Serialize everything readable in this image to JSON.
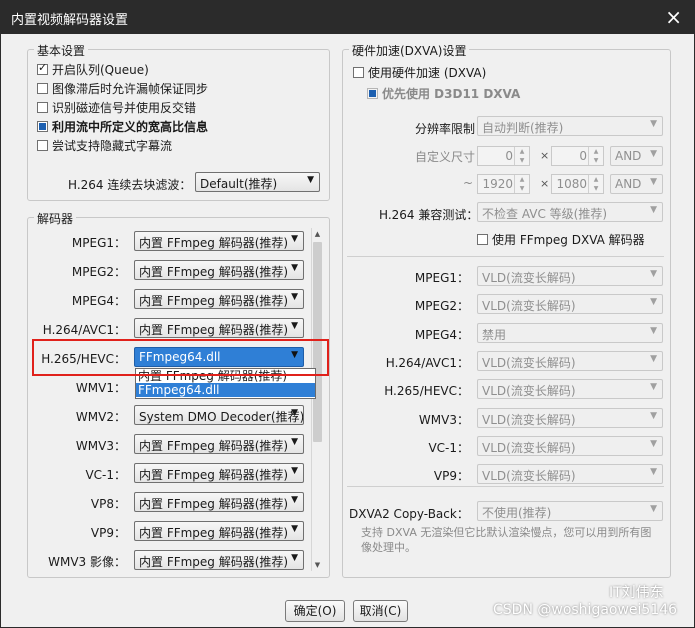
{
  "window": {
    "title": "内置视频解码器设置",
    "close_icon": "×"
  },
  "basic": {
    "legend": "基本设置",
    "options": [
      {
        "label": "开启队列(Queue)",
        "state": "checked",
        "bold": false
      },
      {
        "label": "图像滞后时允许漏帧保证同步",
        "state": "unchecked",
        "bold": false
      },
      {
        "label": "识别磁迹信号并使用反交错",
        "state": "unchecked",
        "bold": false
      },
      {
        "label": "利用流中所定义的宽高比信息",
        "state": "filled",
        "bold": true
      },
      {
        "label": "尝试支持隐藏式字幕流",
        "state": "unchecked",
        "bold": false
      }
    ],
    "deblock_label": "H.264 连续去块滤波：",
    "deblock_value": "Default(推荐)"
  },
  "decoders": {
    "legend": "解码器",
    "rows": [
      {
        "label": "MPEG1：",
        "value": "内置 FFmpeg 解码器(推荐)"
      },
      {
        "label": "MPEG2：",
        "value": "内置 FFmpeg 解码器(推荐)"
      },
      {
        "label": "MPEG4：",
        "value": "内置 FFmpeg 解码器(推荐)"
      },
      {
        "label": "H.264/AVC1：",
        "value": "内置 FFmpeg 解码器(推荐)"
      },
      {
        "label": "H.265/HEVC：",
        "value": "FFmpeg64.dll"
      },
      {
        "label": "WMV1：",
        "value": ""
      },
      {
        "label": "WMV2：",
        "value": "System DMO Decoder(推荐)"
      },
      {
        "label": "WMV3：",
        "value": "内置 FFmpeg 解码器(推荐)"
      },
      {
        "label": "VC-1：",
        "value": "内置 FFmpeg 解码器(推荐)"
      },
      {
        "label": "VP8：",
        "value": "内置 FFmpeg 解码器(推荐)"
      },
      {
        "label": "VP9：",
        "value": "内置 FFmpeg 解码器(推荐)"
      },
      {
        "label": "WMV3 影像：",
        "value": "内置 FFmpeg 解码器(推荐)"
      }
    ],
    "open_dropdown": [
      "内置 FFmpeg 解码器(推荐)",
      "FFmpeg64.dll"
    ]
  },
  "hw": {
    "legend": "硬件加速(DXVA)设置",
    "use_hw": "使用硬件加速 (DXVA)",
    "prefer_d3d11": "优先使用 D3D11 DXVA",
    "resolution_label": "分辨率限制：",
    "resolution_value": "自动判断(推荐)",
    "custom_size_label": "自定义尺寸：",
    "min_w": "0",
    "min_h": "0",
    "min_mode": "AND",
    "tilde": "~",
    "max_w": "1920",
    "max_h": "1080",
    "max_mode": "AND",
    "mult": "×",
    "compat_label": "H.264 兼容测试：",
    "compat_value": "不检查 AVC 等级(推荐)",
    "ffmpeg_dxva": "使用 FFmpeg DXVA 解码器",
    "rows": [
      {
        "label": "MPEG1：",
        "value": "VLD(流变长解码)"
      },
      {
        "label": "MPEG2：",
        "value": "VLD(流变长解码)"
      },
      {
        "label": "MPEG4：",
        "value": "禁用"
      },
      {
        "label": "H.264/AVC1：",
        "value": "VLD(流变长解码)"
      },
      {
        "label": "H.265/HEVC：",
        "value": "VLD(流变长解码)"
      },
      {
        "label": "WMV3：",
        "value": "VLD(流变长解码)"
      },
      {
        "label": "VC-1：",
        "value": "VLD(流变长解码)"
      },
      {
        "label": "VP9：",
        "value": "VLD(流变长解码)"
      }
    ],
    "copyback_label": "DXVA2 Copy-Back：",
    "copyback_value": "不使用(推荐)",
    "note": "支持 DXVA 无渲染但它比默认渲染慢点，您可以用到所有图像处理中。"
  },
  "buttons": {
    "ok": "确定(O)",
    "cancel": "取消(C)"
  },
  "watermark": {
    "brand": "IT刘伟东",
    "csdn": "CSDN @woshigaowei5146"
  },
  "colors": {
    "title_bar": "#2b2b2b",
    "highlight": "#e0211b",
    "selection": "#2f7fd6"
  }
}
